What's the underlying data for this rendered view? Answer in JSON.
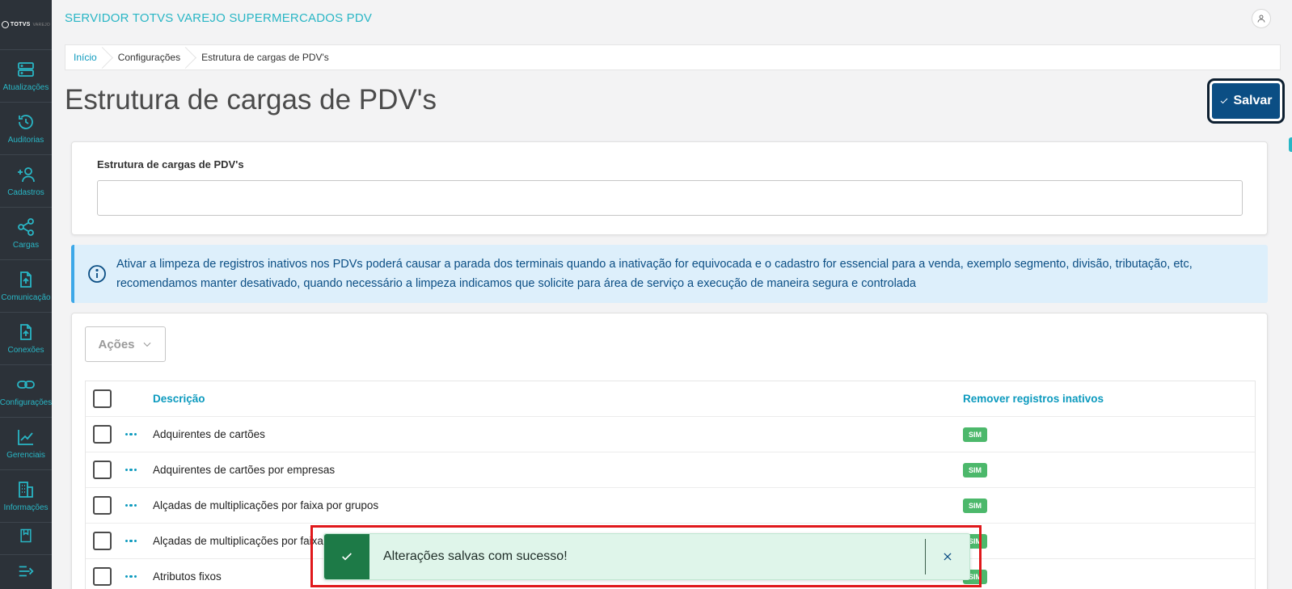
{
  "sidebar": {
    "logo_text": "TOTVS",
    "logo_sub": "VAREJO",
    "items": [
      {
        "label": "Atualizações",
        "icon": "server-icon"
      },
      {
        "label": "Auditorias",
        "icon": "history-icon"
      },
      {
        "label": "Cadastros",
        "icon": "add-user-icon"
      },
      {
        "label": "Cargas",
        "icon": "share-icon"
      },
      {
        "label": "Comunicação",
        "icon": "file-upload-icon"
      },
      {
        "label": "Conexões",
        "icon": "file-upload-icon"
      },
      {
        "label": "Configurações",
        "icon": "link-icon"
      },
      {
        "label": "Gerenciais",
        "icon": "chart-icon"
      },
      {
        "label": "Informações",
        "icon": "building-icon"
      }
    ]
  },
  "header": {
    "app_title": "SERVIDOR TOTVS VAREJO SUPERMERCADOS PDV"
  },
  "breadcrumb": [
    "Início",
    "Configurações",
    "Estrutura de cargas de PDV's"
  ],
  "page": {
    "title": "Estrutura de cargas de PDV's",
    "save_label": "Salvar"
  },
  "form": {
    "field_label": "Estrutura de cargas de PDV's",
    "field_value": ""
  },
  "info_text": "Ativar a limpeza de registros inativos nos PDVs poderá causar a parada dos terminais quando a inativação for equivocada e o cadastro for essencial para a venda, exemplo segmento, divisão, tributação, etc, recomendamos manter desativado, quando necessário a limpeza indicamos que solicite para área de serviço a execução de maneira segura e controlada",
  "actions_label": "Ações",
  "table": {
    "columns": [
      "Descrição",
      "Remover registros inativos"
    ],
    "rows": [
      {
        "descricao": "Adquirentes de cartões",
        "remover": "SIM"
      },
      {
        "descricao": "Adquirentes de cartões por empresas",
        "remover": "SIM"
      },
      {
        "descricao": "Alçadas de multiplicações por faixa por grupos",
        "remover": "SIM"
      },
      {
        "descricao": "Alçadas de multiplicações por faixa",
        "remover": "SIM"
      },
      {
        "descricao": "Atributos fixos",
        "remover": "SIM"
      }
    ]
  },
  "toast": {
    "message": "Alterações salvas com sucesso!"
  },
  "colors": {
    "sidebar_bg": "#2c3239",
    "accent": "#29b6c5",
    "primary": "#0b4e84",
    "success": "#1d7a47",
    "badge": "#4cb86b",
    "info_bg": "#ddeffb"
  }
}
